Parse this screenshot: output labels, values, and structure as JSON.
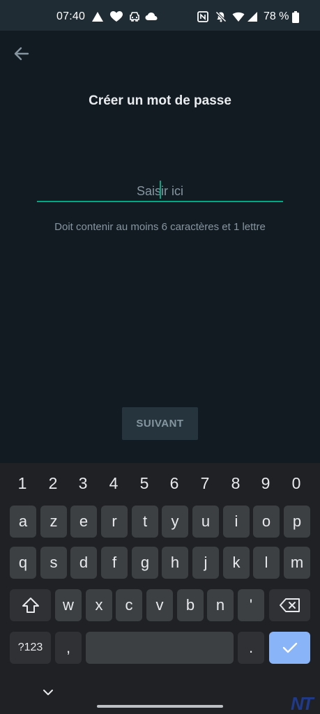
{
  "status_bar": {
    "time": "07:40",
    "battery": "78 %"
  },
  "screen": {
    "title": "Créer un mot de passe",
    "password_placeholder": "Saisir ici",
    "hint": "Doit contenir au moins 6 caractères et 1 lettre",
    "next_label": "SUIVANT"
  },
  "keyboard": {
    "number_row": [
      "1",
      "2",
      "3",
      "4",
      "5",
      "6",
      "7",
      "8",
      "9",
      "0"
    ],
    "row1": [
      "a",
      "z",
      "e",
      "r",
      "t",
      "y",
      "u",
      "i",
      "o",
      "p"
    ],
    "row2": [
      "q",
      "s",
      "d",
      "f",
      "g",
      "h",
      "j",
      "k",
      "l",
      "m"
    ],
    "row3": [
      "w",
      "x",
      "c",
      "v",
      "b",
      "n",
      "'"
    ],
    "symbols_label": "?123",
    "comma": ",",
    "period": "."
  },
  "watermark": "NT",
  "colors": {
    "accent": "#00a884",
    "background": "#121b22",
    "keyboard": "#202124",
    "enter": "#8ab4f8"
  }
}
